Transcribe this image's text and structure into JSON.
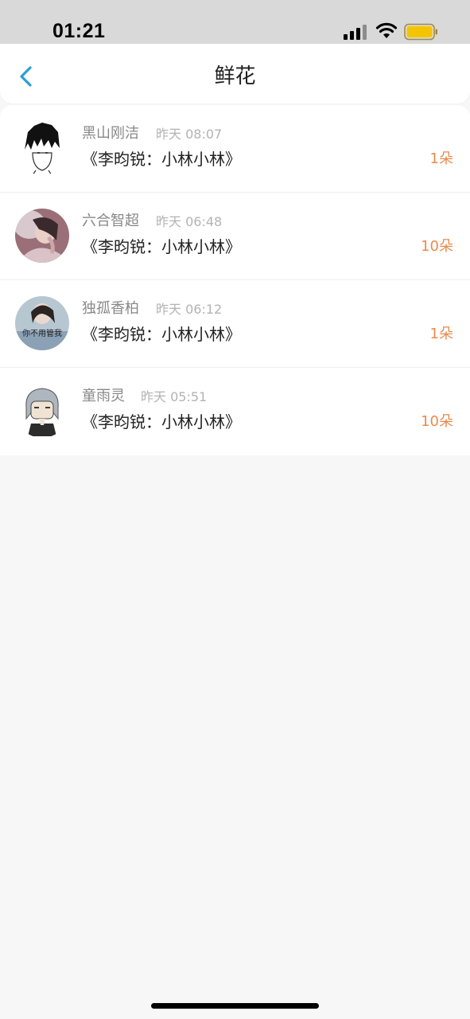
{
  "status_bar": {
    "time": "01:21",
    "signal_icon": "cellular-signal-icon",
    "wifi_icon": "wifi-icon",
    "battery_icon": "battery-icon",
    "battery_color": "#f5c400"
  },
  "nav": {
    "back_icon": "chevron-left-icon",
    "title": "鲜花",
    "accent_color": "#2a9fd6"
  },
  "flowers": [
    {
      "name": "黑山刚洁",
      "time": "昨天 08:07",
      "work": "《李昀锐：小林小林》",
      "count": "1朵"
    },
    {
      "name": "六合智超",
      "time": "昨天 06:48",
      "work": "《李昀锐：小林小林》",
      "count": "10朵"
    },
    {
      "name": "独孤香柏",
      "time": "昨天 06:12",
      "work": "《李昀锐：小林小林》",
      "count": "1朵"
    },
    {
      "name": "童雨灵",
      "time": "昨天 05:51",
      "work": "《李昀锐：小林小林》",
      "count": "10朵"
    }
  ],
  "avatar_captions": [
    "你不用管我"
  ],
  "count_color": "#ea8a4c"
}
